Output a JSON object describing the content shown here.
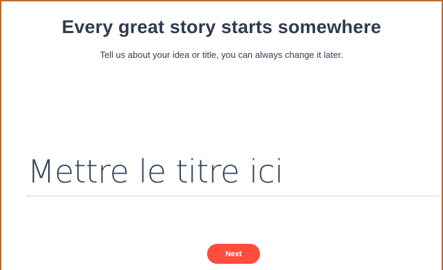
{
  "header": {
    "title": "Every great story starts somewhere",
    "subtitle": "Tell us about your idea or title, you can always change it later."
  },
  "title_field": {
    "placeholder": "Mettre le titre ici",
    "value": ""
  },
  "actions": {
    "next_label": "Next"
  },
  "colors": {
    "text": "#2f3c4e",
    "accent": "#ff4c3b",
    "frame_border": "#c0692a"
  }
}
